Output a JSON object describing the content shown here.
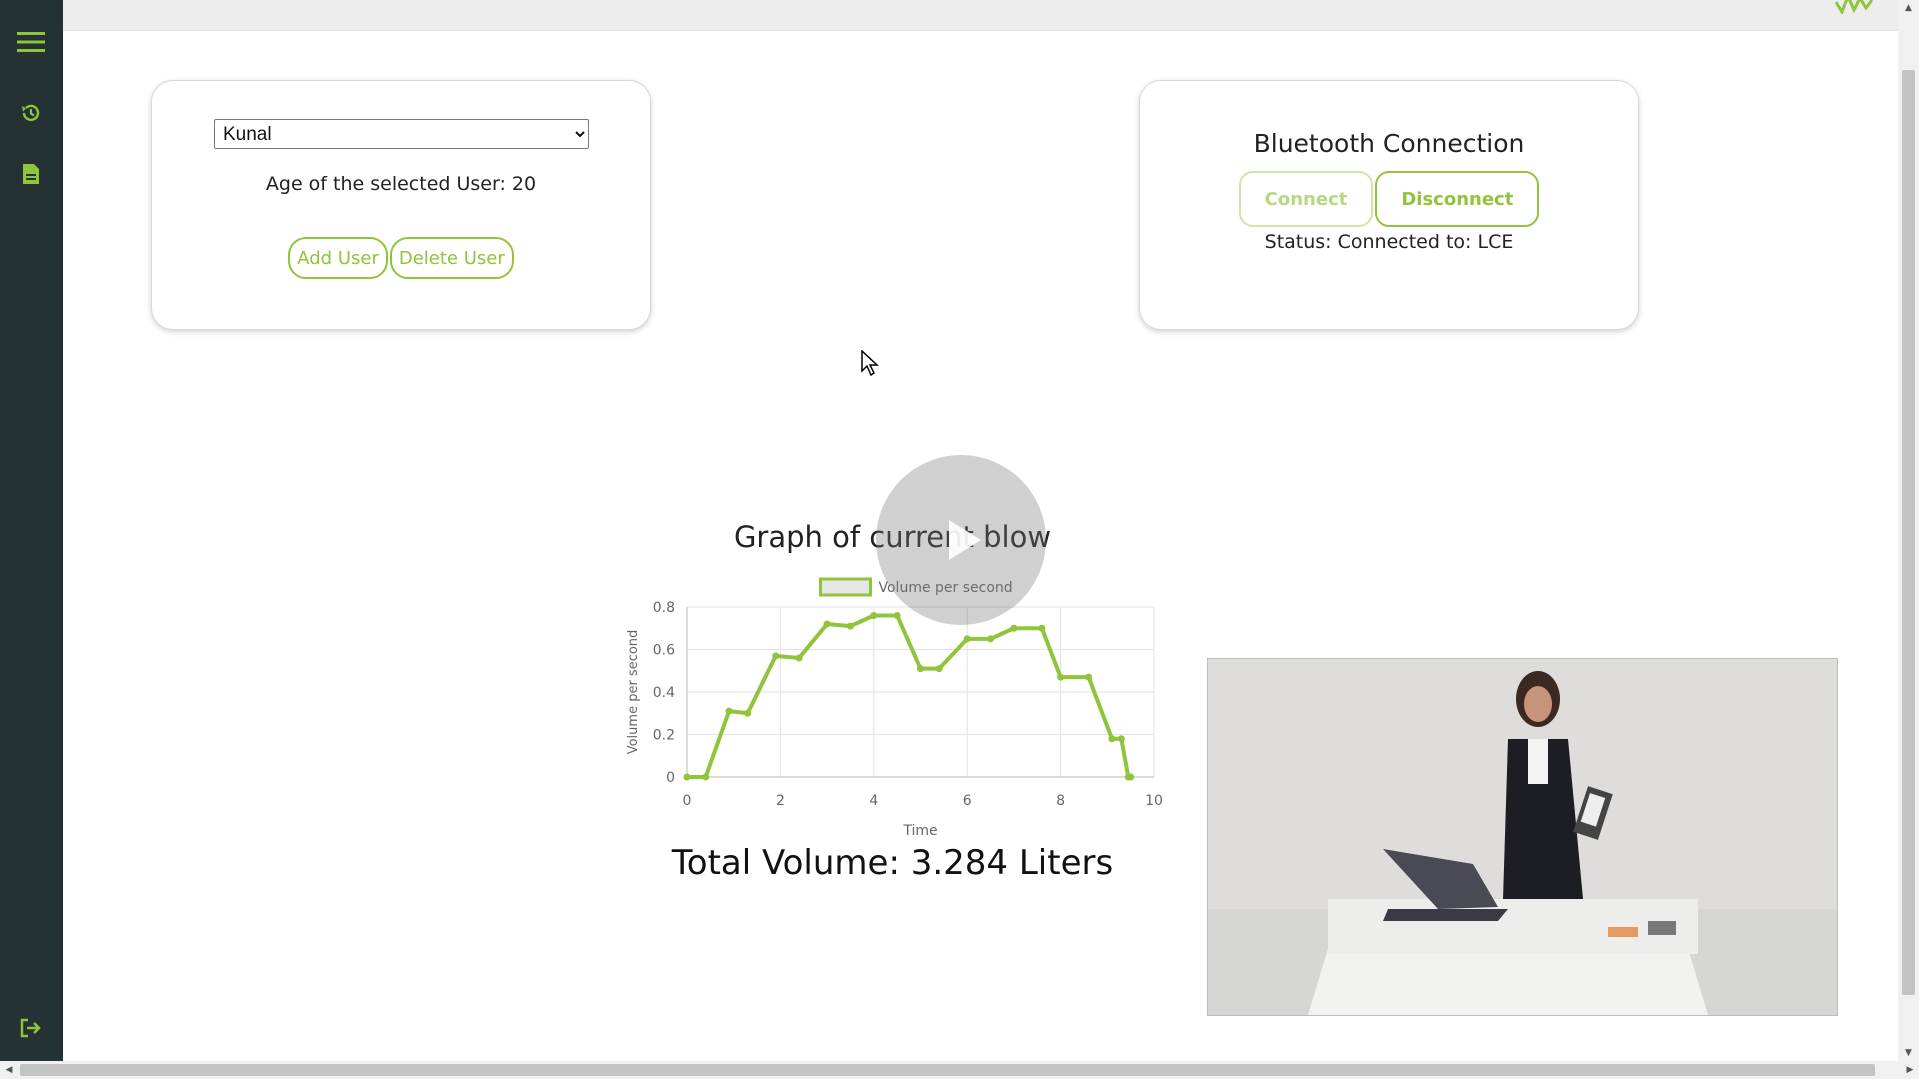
{
  "users": {
    "selected": "Kunal",
    "options": [
      "Kunal"
    ],
    "age_text": "Age of the selected User: 20",
    "add_label": "Add User",
    "delete_label": "Delete User"
  },
  "bluetooth": {
    "title": "Bluetooth Connection",
    "connect_label": "Connect",
    "disconnect_label": "Disconnect",
    "status": "Status: Connected to: LCE"
  },
  "graph": {
    "title": "Graph of current blow",
    "total": "Total Volume: 3.284 Liters"
  },
  "colors": {
    "accent": "#8fc43b",
    "sidebar": "#253234"
  },
  "icons": [
    "menu-icon",
    "history-icon",
    "report-icon",
    "logout-icon",
    "play-icon"
  ],
  "chart_data": {
    "type": "line",
    "title": "",
    "legend": [
      "Volume per second"
    ],
    "legend_position": "top-center",
    "xlabel": "Time",
    "ylabel": "Volume per second",
    "xlim": [
      0,
      10
    ],
    "ylim": [
      0,
      0.8
    ],
    "xticks": [
      0,
      2,
      4,
      6,
      8,
      10
    ],
    "yticks": [
      0,
      0.2,
      0.4,
      0.6,
      0.8
    ],
    "grid": true,
    "series": [
      {
        "name": "Volume per second",
        "color": "#8fc43b",
        "x": [
          0.0,
          0.4,
          0.9,
          1.3,
          1.9,
          2.4,
          3.0,
          3.5,
          4.0,
          4.5,
          5.0,
          5.4,
          6.0,
          6.5,
          7.0,
          7.6,
          8.0,
          8.6,
          9.1,
          9.3,
          9.45,
          9.5
        ],
        "y": [
          0.0,
          0.0,
          0.31,
          0.3,
          0.57,
          0.56,
          0.72,
          0.71,
          0.76,
          0.76,
          0.51,
          0.51,
          0.65,
          0.65,
          0.7,
          0.7,
          0.47,
          0.47,
          0.18,
          0.18,
          0.0,
          0.0
        ]
      }
    ]
  }
}
